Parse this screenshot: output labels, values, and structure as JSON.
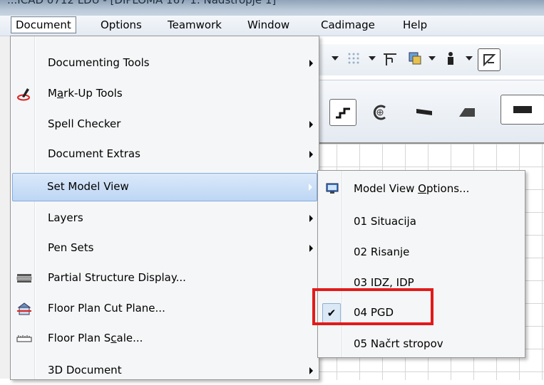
{
  "titlebar": {
    "text": "...ICAD 0712 LDU - [DIPLOMA 167 1. Nadstropje 1]"
  },
  "menubar": {
    "items": [
      {
        "label": "Document",
        "active": true
      },
      {
        "label": "Options"
      },
      {
        "label": "Teamwork"
      },
      {
        "label": "Window"
      },
      {
        "label": "Cadimage"
      },
      {
        "label": "Help"
      }
    ]
  },
  "document_menu": {
    "items": [
      {
        "label": "Documenting Tools",
        "submenu": true
      },
      {
        "label": "Mark-Up Tools",
        "icon": "markup-pen-icon"
      },
      {
        "label": "Spell Checker",
        "submenu": true
      },
      {
        "label": "Document Extras",
        "submenu": true
      },
      {
        "label": "Set Model View",
        "submenu": true,
        "highlighted": true
      },
      {
        "label": "Layers",
        "submenu": true
      },
      {
        "label": "Pen Sets",
        "submenu": true
      },
      {
        "label": "Partial Structure Display...",
        "icon": "structure-display-icon"
      },
      {
        "label": "Floor Plan Cut Plane...",
        "icon": "cut-plane-icon"
      },
      {
        "label": "Floor Plan Scale...",
        "icon": "scale-ruler-icon"
      },
      {
        "label": "3D Document",
        "submenu": true
      }
    ]
  },
  "model_view_submenu": {
    "items": [
      {
        "label": "Model View Options...",
        "icon": "model-view-options-icon"
      },
      {
        "label": "01 Situacija"
      },
      {
        "label": "02 Risanje"
      },
      {
        "label": "03 IDZ, IDP"
      },
      {
        "label": "04 PGD",
        "checked": true
      },
      {
        "label": "05 Načrt stropov"
      }
    ],
    "check_glyph": "✔"
  },
  "colors": {
    "highlight_top": "#dbe9fa",
    "highlight_bottom": "#bdd6f4",
    "annotation_red": "#e31a1a",
    "menu_bg": "#f5f6f7"
  }
}
